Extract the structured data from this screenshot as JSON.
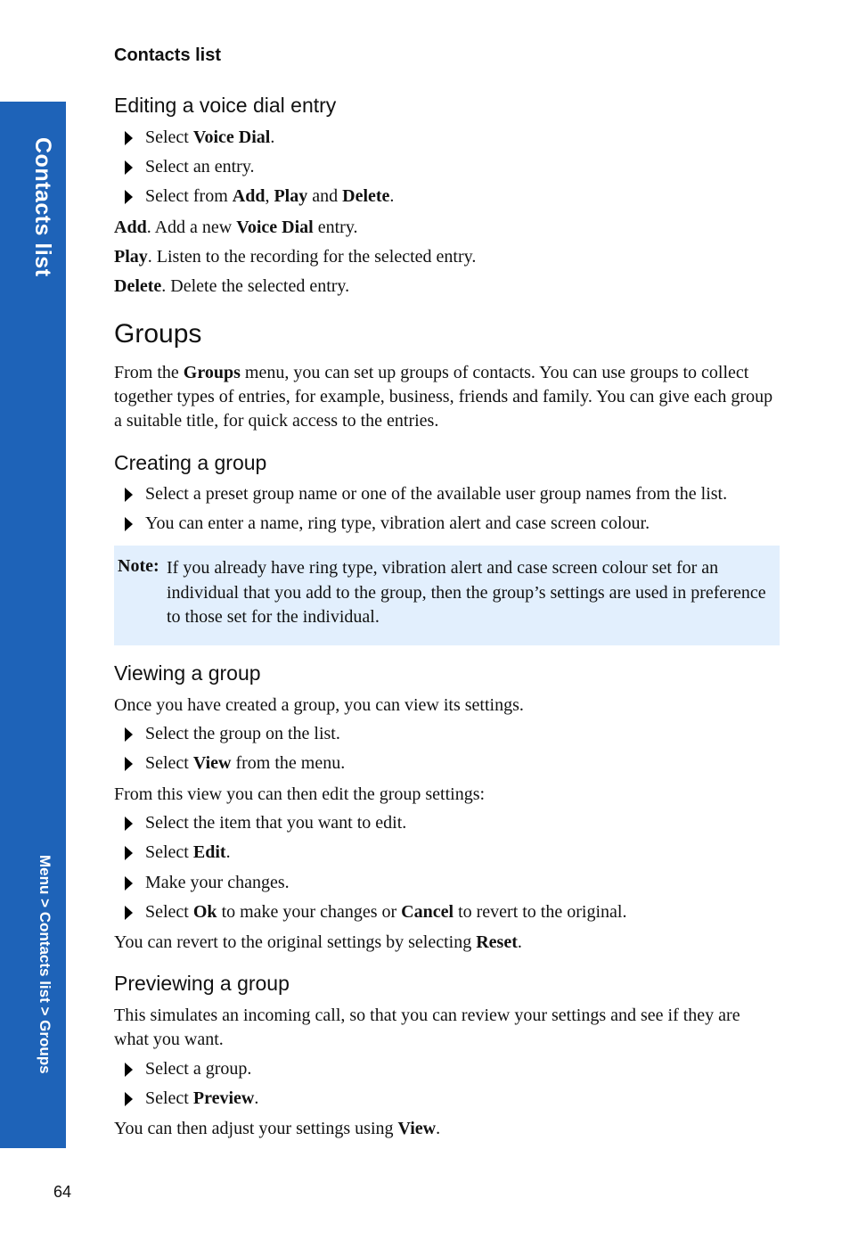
{
  "running_head": "Contacts list",
  "side_tab": {
    "title": "Contacts list",
    "breadcrumb": "Menu > Contacts list > Groups",
    "color": "#1e63b8"
  },
  "page_number": "64",
  "editing": {
    "heading": "Editing a voice dial entry",
    "steps": [
      {
        "pre": "Select ",
        "b1": "Voice Dial",
        "post": "."
      },
      {
        "pre": "Select an entry."
      },
      {
        "pre": "Select from ",
        "b1": "Add",
        "mid1": ", ",
        "b2": "Play",
        "mid2": " and ",
        "b3": "Delete",
        "post": "."
      }
    ],
    "defs": [
      {
        "term": "Add",
        "text": ". Add a new ",
        "b": "Voice Dial",
        "post": " entry."
      },
      {
        "term": "Play",
        "text": ". Listen to the recording for the selected entry."
      },
      {
        "term": "Delete",
        "text": ". Delete the selected entry."
      }
    ]
  },
  "groups": {
    "heading": "Groups",
    "intro_pre": "From the ",
    "intro_b": "Groups",
    "intro_post": " menu, you can set up groups of contacts. You can use groups to collect together types of entries, for example, business, friends and family. You can give each group a suitable title, for quick access to the entries."
  },
  "creating": {
    "heading": "Creating a group",
    "steps": [
      "Select a preset group name or one of the available user group names from the list.",
      "You can enter a name, ring type, vibration alert and case screen colour."
    ]
  },
  "note": {
    "label": "Note:",
    "text": "If you already have ring type, vibration alert and case screen colour set for an individual that you add to the group, then the group’s settings are used in preference to those set for the individual.",
    "background": "#e2effd"
  },
  "viewing": {
    "heading": "Viewing a group",
    "intro": "Once you have created a group, you can view its settings.",
    "steps1": [
      {
        "pre": "Select the group on the list."
      },
      {
        "pre": "Select ",
        "b": "View",
        "post": " from the menu."
      }
    ],
    "mid": "From this view you can then edit the group settings:",
    "steps2": [
      {
        "pre": "Select the item that you want to edit."
      },
      {
        "pre": "Select ",
        "b": "Edit",
        "post": "."
      },
      {
        "pre": "Make your changes."
      },
      {
        "pre": "Select ",
        "b": "Ok",
        "post": " to make your changes or ",
        "b2": "Cancel",
        "post2": " to revert to the original."
      }
    ],
    "end_pre": "You can revert to the original settings by selecting ",
    "end_b": "Reset",
    "end_post": "."
  },
  "previewing": {
    "heading": "Previewing a group",
    "intro": "This simulates an incoming call, so that you can review your settings and see if they are what you want.",
    "steps": [
      {
        "pre": "Select a group."
      },
      {
        "pre": "Select ",
        "b": "Preview",
        "post": "."
      }
    ],
    "end_pre": "You can then adjust your settings using ",
    "end_b": "View",
    "end_post": "."
  }
}
